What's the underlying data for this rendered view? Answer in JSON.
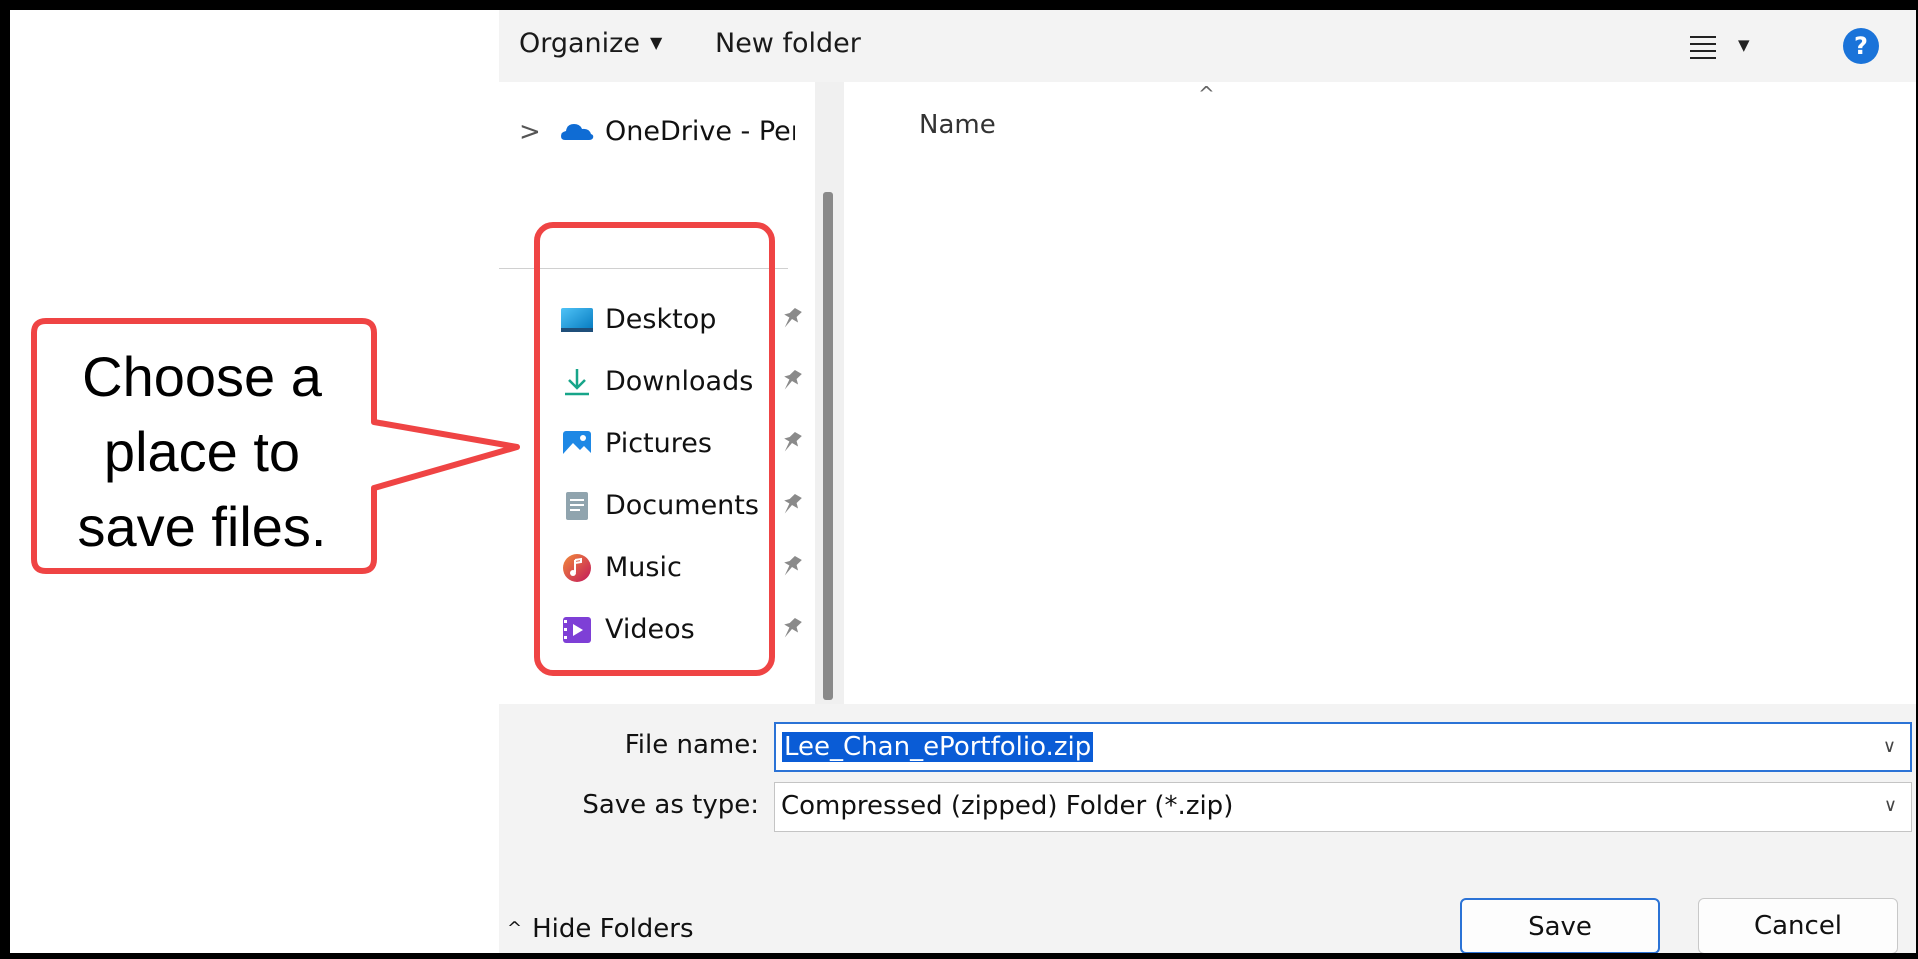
{
  "toolbar": {
    "organize_label": "Organize",
    "new_folder_label": "New folder",
    "help_label": "?"
  },
  "nav": {
    "onedrive_label": "OneDrive - Perso",
    "quick_access": [
      {
        "label": "Desktop",
        "icon": "desktop-icon"
      },
      {
        "label": "Downloads",
        "icon": "downloads-icon"
      },
      {
        "label": "Pictures",
        "icon": "pictures-icon"
      },
      {
        "label": "Documents",
        "icon": "documents-icon"
      },
      {
        "label": "Music",
        "icon": "music-icon"
      },
      {
        "label": "Videos",
        "icon": "videos-icon"
      }
    ]
  },
  "filelist": {
    "column_name": "Name"
  },
  "form": {
    "file_name_label": "File name:",
    "file_name_value": "Lee_Chan_ePortfolio.zip",
    "save_as_type_label": "Save as type:",
    "save_as_type_value": "Compressed (zipped) Folder (*.zip)",
    "hide_folders_label": "Hide Folders",
    "save_button": "Save",
    "cancel_button": "Cancel"
  },
  "callout": {
    "lines": [
      "Choose a",
      "place to",
      "save files."
    ],
    "color": "#ef4444"
  },
  "colors": {
    "accent": "#1a73d9",
    "selection": "#0a5cd6",
    "callout_border": "#ef4444"
  }
}
